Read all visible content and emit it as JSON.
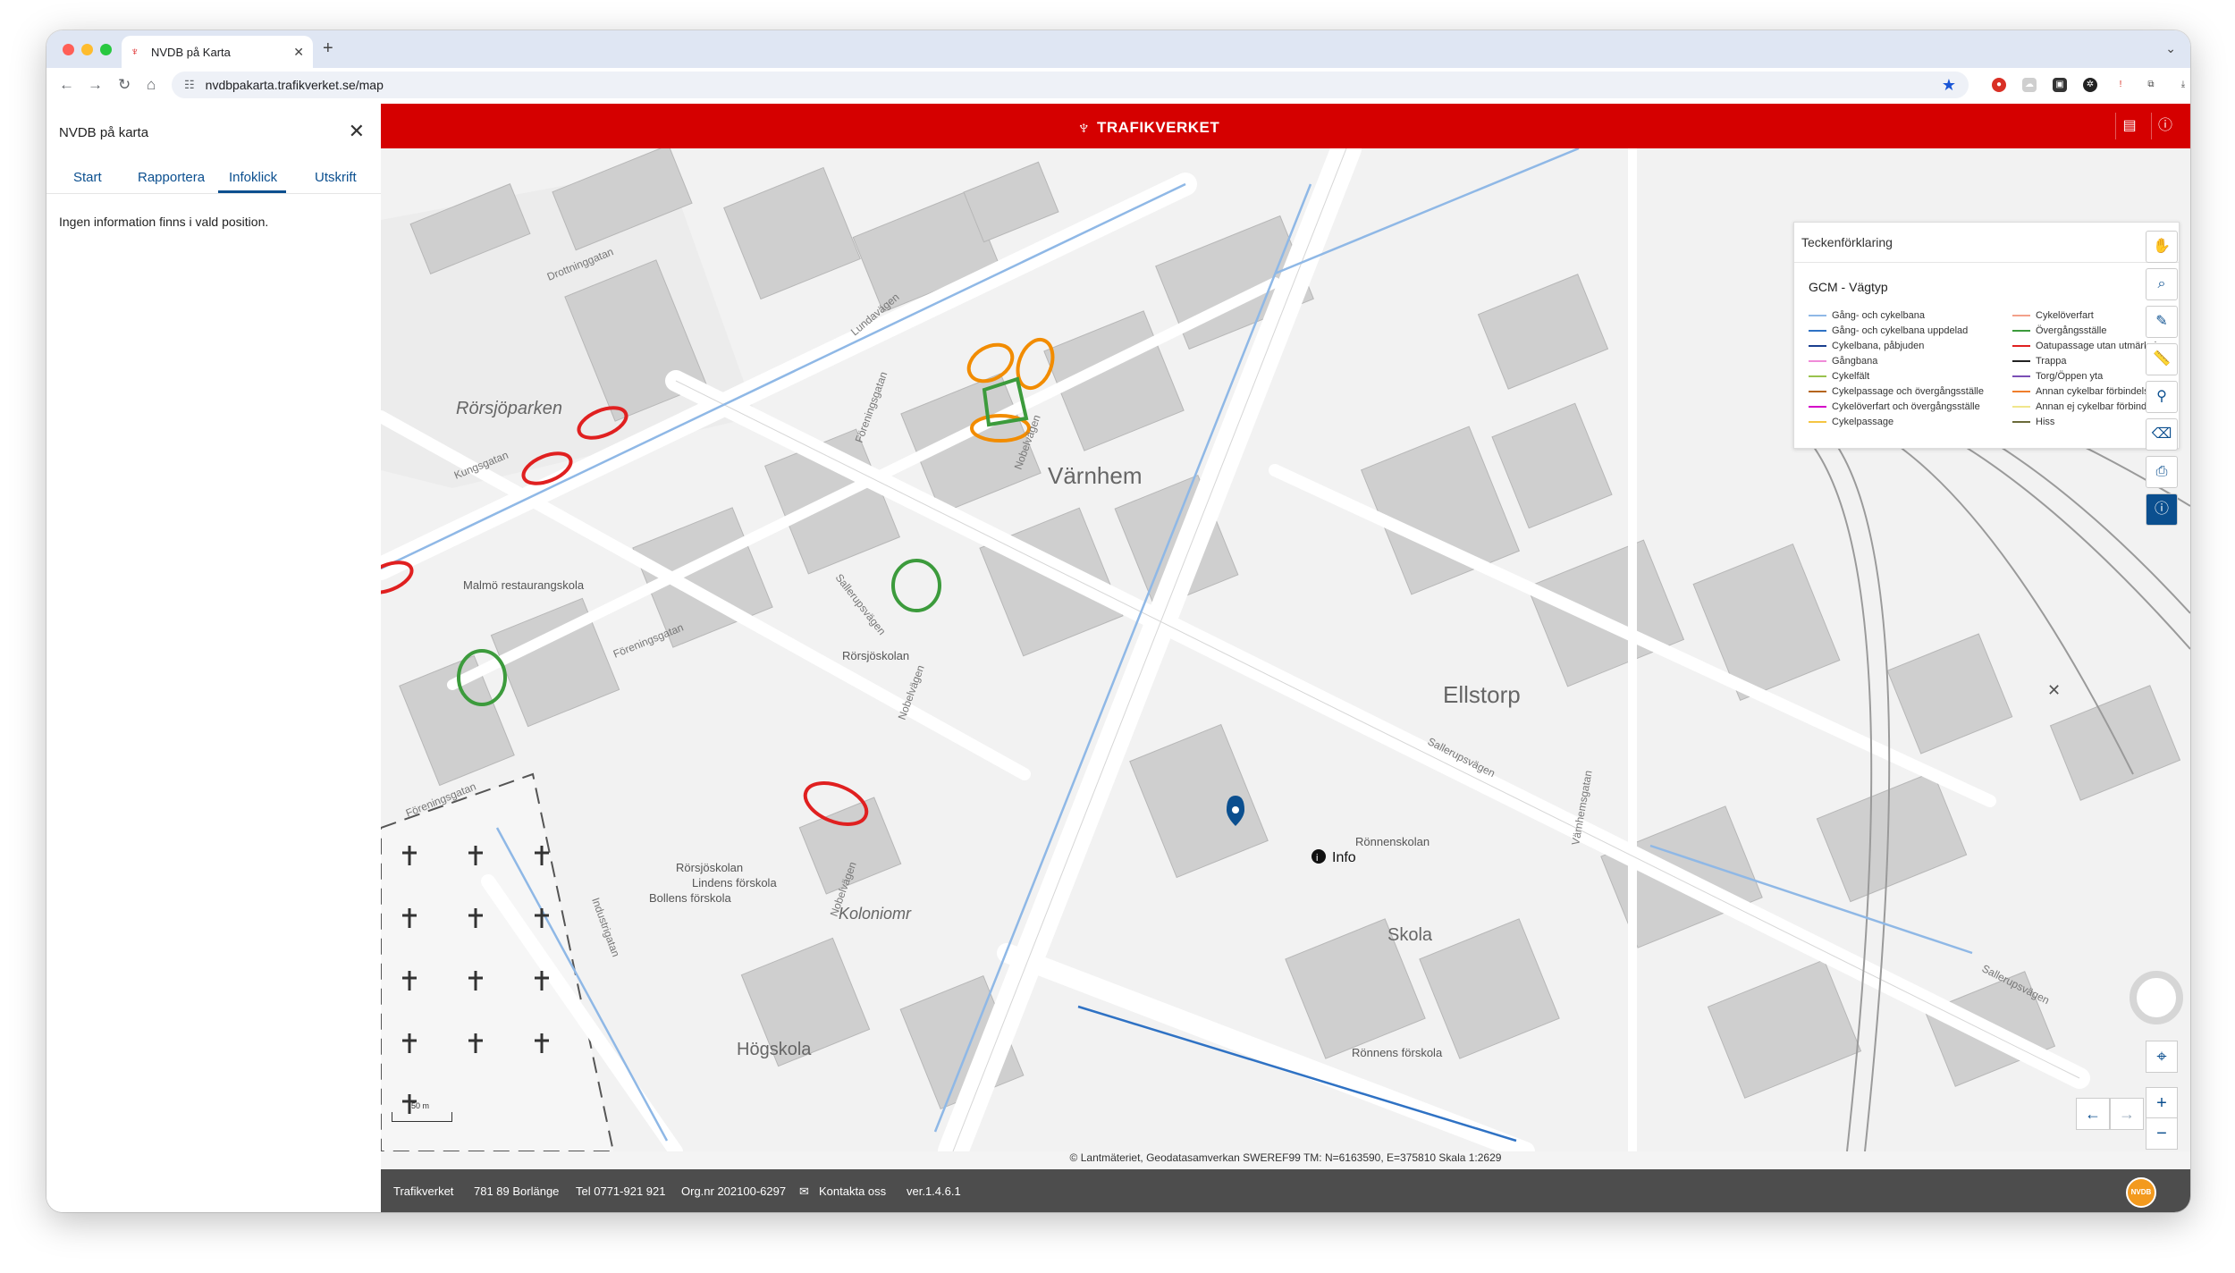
{
  "browser": {
    "tab_title": "NVDB på Karta",
    "url": "nvdbpakarta.trafikverket.se/map"
  },
  "sidepanel": {
    "title": "NVDB på karta",
    "tabs": [
      {
        "label": "Start"
      },
      {
        "label": "Rapportera"
      },
      {
        "label": "Infoklick",
        "active": true
      },
      {
        "label": "Utskrift"
      }
    ],
    "info_text": "Ingen information finns i vald position."
  },
  "header": {
    "brand": "TRAFIKVERKET"
  },
  "legend": {
    "title": "Teckenförklaring",
    "section": "GCM - Vägtyp",
    "items": [
      {
        "label": "Gång- och cykelbana",
        "color": "#8fb8e6"
      },
      {
        "label": "Gång- och cykelbana uppdelad",
        "color": "#2f72c4"
      },
      {
        "label": "Cykelbana, påbjuden",
        "color": "#1a3f8f"
      },
      {
        "label": "Gångbana",
        "color": "#f08bd8"
      },
      {
        "label": "Cykelfält",
        "color": "#99c24d"
      },
      {
        "label": "Cykelpassage och övergångsställe",
        "color": "#b5651d"
      },
      {
        "label": "Cykelöverfart och övergångsställe",
        "color": "#d400c8"
      },
      {
        "label": "Cykelpassage",
        "color": "#f5c542"
      },
      {
        "label": "Cykelöverfart",
        "color": "#f3a08a"
      },
      {
        "label": "Övergångsställe",
        "color": "#3c9b3c"
      },
      {
        "label": "Oatupassage utan utmärkning",
        "color": "#e02020"
      },
      {
        "label": "Trappa",
        "color": "#222222"
      },
      {
        "label": "Torg/Öppen yta",
        "color": "#7a4fb5"
      },
      {
        "label": "Annan cykelbar förbindelse",
        "color": "#f07e2b"
      },
      {
        "label": "Annan ej cykelbar förbindelse",
        "color": "#f0e68c"
      },
      {
        "label": "Hiss",
        "color": "#6b6b3a"
      }
    ]
  },
  "map": {
    "place_labels": {
      "rorsjoparken": "Rörsjöparken",
      "varnhem": "Värnhem",
      "ellstorp": "Ellstorp",
      "koloniomr": "Koloniomr",
      "hogskola": "Högskola",
      "skola": "Skola"
    },
    "street_labels": {
      "drottninggatan": "Drottninggatan",
      "kungsgatan": "Kungsgatan",
      "foreningsgatan1": "Föreningsgatan",
      "foreningsgatan2": "Föreningsgatan",
      "foreningsgatan3": "Föreningsgatan",
      "nobelvagen1": "Nobelvägen",
      "nobelvagen2": "Nobelvägen",
      "nobelvagen3": "Nobelvägen",
      "sallerupsvagen1": "Sallerupsvägen",
      "sallerupsvagen2": "Sallerupsvägen",
      "sallerupsvagen3": "Sallerupsvägen",
      "industrigatan": "Industrigatan",
      "lundavagen": "Lundavägen",
      "vanhemsgatan": "Värnhemsgatan"
    },
    "poi_labels": {
      "malmo_restaurangskola": "Malmö restaurangskola",
      "rorsjoskolan1": "Rörsjöskolan",
      "rorsjoskolan2": "Rörsjöskolan",
      "lindens_forskola": "Lindens förskola",
      "bollens_forskola": "Bollens förskola",
      "ronnenskolan": "Rönnenskolan",
      "ronnens_forskola": "Rönnens förskola"
    },
    "info_marker_label": "Info",
    "scale_label": "50 m",
    "attribution": "© Lantmäteriet, Geodatasamverkan SWEREF99 TM: N=6163590, E=375810 Skala 1:2629"
  },
  "footer": {
    "org": "Trafikverket",
    "address": "781 89 Borlänge",
    "phone": "Tel 0771-921 921",
    "orgnr": "Org.nr 202100-6297",
    "contact": "Kontakta oss",
    "version": "ver.1.4.6.1",
    "badge": "NVDB"
  },
  "colors": {
    "brand_red": "#d50000",
    "accent_blue": "#0b4f8f",
    "footer_grey": "#4d4d4d"
  }
}
